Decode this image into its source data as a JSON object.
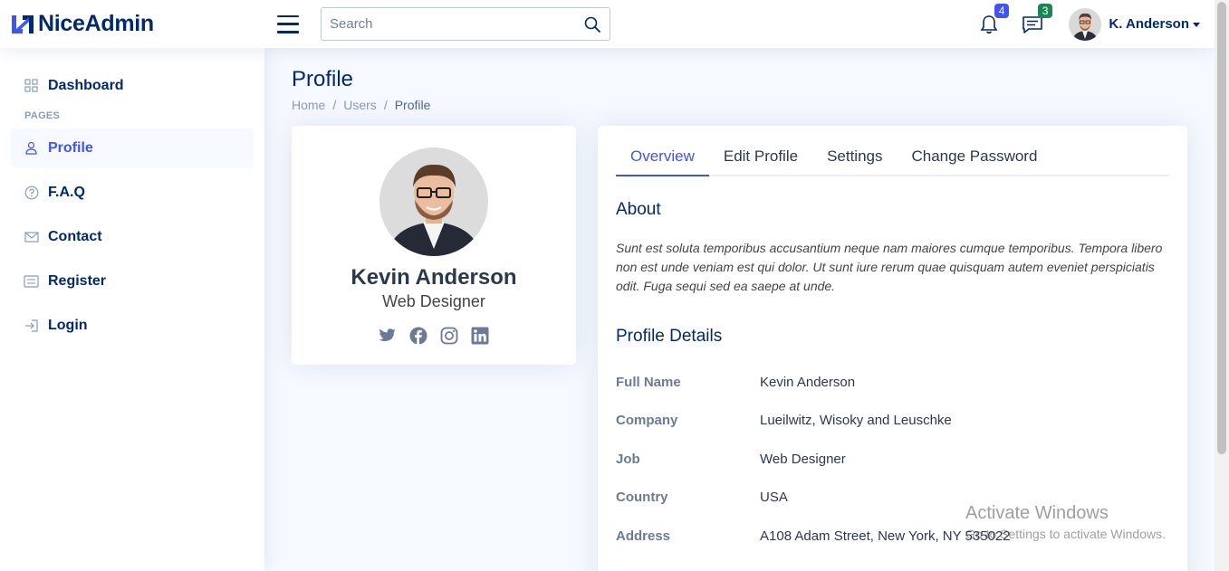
{
  "app": {
    "name": "NiceAdmin"
  },
  "header": {
    "search_placeholder": "Search",
    "notifications_count": "4",
    "messages_count": "3",
    "user_name": "K. Anderson"
  },
  "sidebar": {
    "items": [
      {
        "label": "Dashboard",
        "icon": "grid-icon"
      },
      {
        "label": "Profile",
        "icon": "person-icon"
      },
      {
        "label": "F.A.Q",
        "icon": "question-icon"
      },
      {
        "label": "Contact",
        "icon": "envelope-icon"
      },
      {
        "label": "Register",
        "icon": "card-list-icon"
      },
      {
        "label": "Login",
        "icon": "login-icon"
      }
    ],
    "heading_pages": "PAGES"
  },
  "page": {
    "title": "Profile",
    "breadcrumb": [
      "Home",
      "Users",
      "Profile"
    ],
    "breadcrumb_sep": "/"
  },
  "profile_card": {
    "name": "Kevin Anderson",
    "job": "Web Designer",
    "socials": [
      "twitter-icon",
      "facebook-icon",
      "instagram-icon",
      "linkedin-icon"
    ]
  },
  "tabs": [
    "Overview",
    "Edit Profile",
    "Settings",
    "Change Password"
  ],
  "overview": {
    "about_title": "About",
    "about_text": "Sunt est soluta temporibus accusantium neque nam maiores cumque temporibus. Tempora libero non est unde veniam est qui dolor. Ut sunt iure rerum quae quisquam autem eveniet perspiciatis odit. Fuga sequi sed ea saepe at unde.",
    "details_title": "Profile Details",
    "details": [
      {
        "label": "Full Name",
        "value": "Kevin Anderson"
      },
      {
        "label": "Company",
        "value": "Lueilwitz, Wisoky and Leuschke"
      },
      {
        "label": "Job",
        "value": "Web Designer"
      },
      {
        "label": "Country",
        "value": "USA"
      },
      {
        "label": "Address",
        "value": "A108 Adam Street, New York, NY 535022"
      }
    ]
  },
  "watermark": {
    "line1": "Activate Windows",
    "line2": "Go to Settings to activate Windows."
  },
  "colors": {
    "primary": "#4154f1",
    "navy": "#012970",
    "bg": "#f6f9ff"
  }
}
